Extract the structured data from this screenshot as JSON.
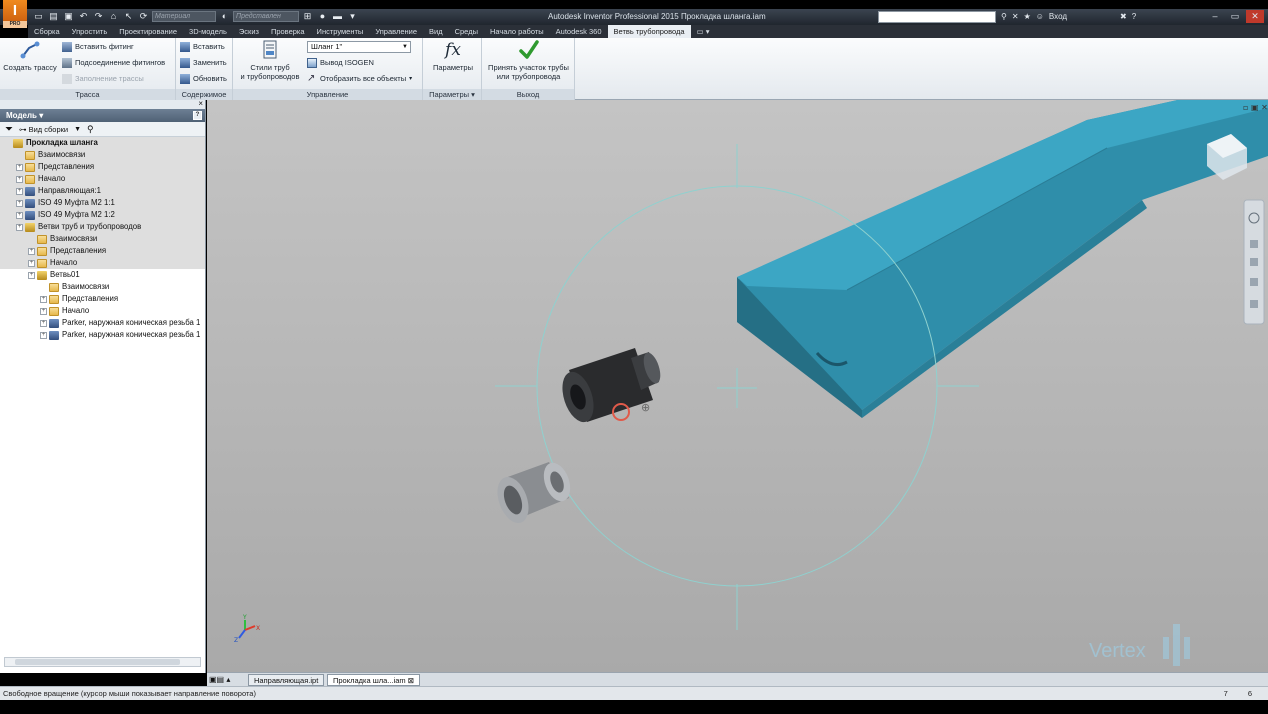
{
  "app": {
    "logo": "I",
    "logo_sub": "PRO",
    "title": "Autodesk Inventor Professional 2015    Прокладка шланга.iam"
  },
  "quick_access": {
    "material_placeholder": "Материал",
    "representation_placeholder": "Представлен"
  },
  "titlebar_right": {
    "user_label": "Вход"
  },
  "menu": {
    "tabs": [
      "Сборка",
      "Упростить",
      "Проектирование",
      "3D-модель",
      "Эскиз",
      "Проверка",
      "Инструменты",
      "Управление",
      "Вид",
      "Среды",
      "Начало работы",
      "Autodesk 360",
      "Ветвь трубопровода"
    ],
    "active_index": 12
  },
  "ribbon": {
    "route_panel": {
      "title": "Трасса",
      "create_route": "Создать трассу",
      "insert_fitting": "Вставить фитинг",
      "connect_fittings": "Подсоединение фитингов",
      "populate_route": "Заполнение трассы"
    },
    "content_panel": {
      "title": "Содержимое",
      "insert": "Вставить",
      "replace": "Заменить",
      "update": "Обновить"
    },
    "manage_panel": {
      "title": "Управление",
      "tube_styles_line1": "Стили труб",
      "tube_styles_line2": "и трубопроводов",
      "style_combo_value": "Шланг 1\"",
      "isogen_output": "Вывод ISOGEN",
      "show_all_objects": "Отобразить все объекты"
    },
    "params_panel": {
      "title": "Параметры",
      "parameters": "Параметры"
    },
    "exit_panel": {
      "title": "Выход",
      "accept_line1": "Принять участок трубы",
      "accept_line2": "или трубопровода"
    }
  },
  "browser": {
    "title": "Модель",
    "view_label": "Вид сборки",
    "tree": [
      {
        "label": "Прокладка шланга",
        "level": 0,
        "icon": "assembly-icon",
        "bold": true,
        "shaded": true
      },
      {
        "label": "Взаимосвязи",
        "level": 1,
        "icon": "folder-icon",
        "shaded": true
      },
      {
        "label": "Представления",
        "level": 1,
        "icon": "representations-icon",
        "shaded": true
      },
      {
        "label": "Начало",
        "level": 1,
        "icon": "folder-icon",
        "shaded": true
      },
      {
        "label": "Направляющая:1",
        "level": 1,
        "icon": "part-icon",
        "shaded": true
      },
      {
        "label": "ISO 49 Муфта M2 1:1",
        "level": 1,
        "icon": "fitting-icon",
        "shaded": true
      },
      {
        "label": "ISO 49 Муфта M2 1:2",
        "level": 1,
        "icon": "fitting-icon",
        "shaded": true
      },
      {
        "label": "Ветви труб и трубопроводов",
        "level": 1,
        "icon": "tube-runs-icon",
        "shaded": true
      },
      {
        "label": "Взаимосвязи",
        "level": 2,
        "icon": "folder-icon",
        "shaded": true
      },
      {
        "label": "Представления",
        "level": 2,
        "icon": "representations-icon",
        "shaded": true
      },
      {
        "label": "Начало",
        "level": 2,
        "icon": "folder-icon",
        "shaded": true
      },
      {
        "label": "Ветвь01",
        "level": 2,
        "icon": "run-icon",
        "shaded": false
      },
      {
        "label": "Взаимосвязи",
        "level": 3,
        "icon": "folder-icon",
        "shaded": false
      },
      {
        "label": "Представления",
        "level": 3,
        "icon": "representations-icon",
        "shaded": false
      },
      {
        "label": "Начало",
        "level": 3,
        "icon": "folder-icon",
        "shaded": false
      },
      {
        "label": "Parker, наружная коническая резьба 1",
        "level": 3,
        "icon": "fitting-icon",
        "shaded": false
      },
      {
        "label": "Parker, наружная коническая резьба 1",
        "level": 3,
        "icon": "fitting-icon",
        "shaded": false
      }
    ]
  },
  "viewport": {
    "watermark": "Vertex",
    "axis_labels": [
      "X",
      "Y",
      "Z"
    ]
  },
  "doc_tabs": [
    "Направляющая.ipt",
    "Прокладка шла...iam"
  ],
  "status": {
    "message": "Свободное вращение (курсор мыши показывает направление поворота)",
    "count1": "7",
    "count2": "6"
  },
  "colors": {
    "guide_part": "#3a9ab8",
    "orbit_circle": "#8fd1cf"
  }
}
